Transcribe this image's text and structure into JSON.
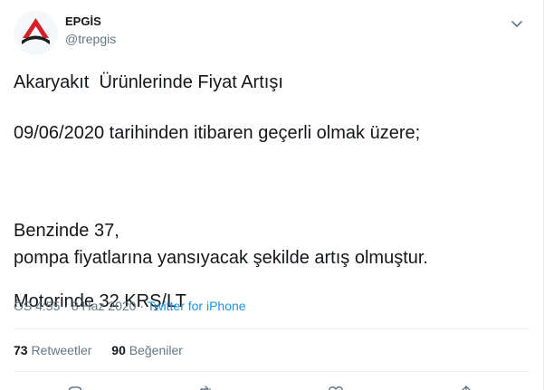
{
  "author": {
    "name": "EPGİS",
    "handle": "@trepgis"
  },
  "tweet": {
    "lines": [
      "Akaryakıt  Ürünlerinde Fiyat Artışı",
      "09/06/2020 tarihinden itibaren geçerli olmak üzere;",
      "Benzinde 37,",
      "Motorinde 32 KRŞ/LT",
      "pompa fiyatlarına yansıyacak şekilde artış olmuştur."
    ]
  },
  "meta": {
    "time": "ÖS 4:55",
    "separator": " · ",
    "date": "8 Haz 2020",
    "source": "Twitter for iPhone"
  },
  "stats": {
    "retweets_count": "73",
    "retweets_label": "Retweetler",
    "likes_count": "90",
    "likes_label": "Beğeniler"
  },
  "colors": {
    "accent": "#1b95e0",
    "muted": "#657786",
    "text": "#14171a",
    "logo_red": "#d3202a"
  },
  "icons": [
    "caret-down-icon",
    "reply-icon",
    "retweet-icon",
    "like-icon",
    "share-icon"
  ]
}
